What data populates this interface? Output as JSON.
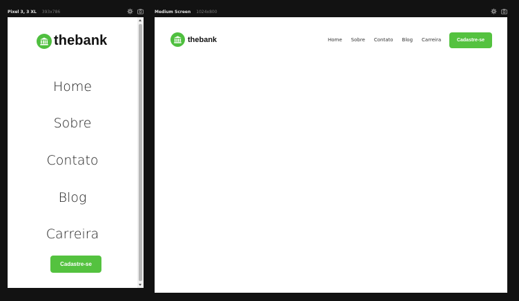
{
  "frames": {
    "mobile": {
      "title": "Pixel 3, 3 XL",
      "dims": "393x786"
    },
    "desktop": {
      "title": "Medium Screen",
      "dims": "1024x800"
    }
  },
  "brand": {
    "name": "thebank",
    "accent": "#54c23f"
  },
  "nav": {
    "items": [
      {
        "label": "Home"
      },
      {
        "label": "Sobre"
      },
      {
        "label": "Contato"
      },
      {
        "label": "Blog"
      },
      {
        "label": "Carreira"
      }
    ],
    "cta_label": "Cadastre-se"
  },
  "icons": {
    "settings": "gear-icon",
    "screenshot": "camera-icon",
    "logo": "bank-icon"
  }
}
